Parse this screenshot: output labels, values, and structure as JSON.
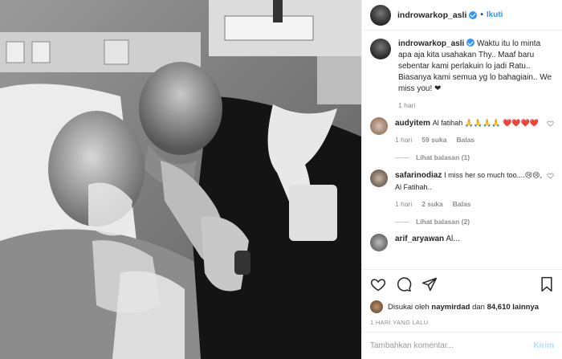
{
  "header": {
    "username": "indrowarkop_asli",
    "separator": "•",
    "follow_label": "Ikuti"
  },
  "caption": {
    "username": "indrowarkop_asli",
    "text": "Waktu itu lo minta apa aja kita usahakan Thy.. Maaf baru sebentar kami perlakuin lo jadi Ratu.. Biasanya kami semua yg lo bahagiain.. We miss you! ❤",
    "time": "1 hari"
  },
  "comments": [
    {
      "username": "audyitem",
      "text": "Al fatihah 🙏🙏🙏🙏 ❤️❤️❤️❤️",
      "time": "1 hari",
      "likes": "59 suka",
      "reply_label": "Balas",
      "replies": "Lihat balasan (1)"
    },
    {
      "username": "safarinodiaz",
      "text": "I miss her so much too....😢😢, Al Fatihah..",
      "time": "1 hari",
      "likes": "2 suka",
      "reply_label": "Balas",
      "replies": "Lihat balasan (2)"
    },
    {
      "username": "arif_aryawan",
      "text": "Al..."
    }
  ],
  "liked_by": {
    "prefix": "Disukai oleh",
    "user": "naymirdad",
    "middle": "dan",
    "count": "84,610 lainnya"
  },
  "timestamp": "1 HARI YANG LALU",
  "add_comment": {
    "placeholder": "Tambahkan komentar...",
    "send_label": "Kirim"
  },
  "icons": [
    "heart-icon",
    "comment-icon",
    "share-icon",
    "bookmark-icon",
    "verified-icon"
  ],
  "colors": {
    "link": "#3897f0",
    "muted": "#8e8e8e",
    "send_disabled": "#b2dffc"
  }
}
